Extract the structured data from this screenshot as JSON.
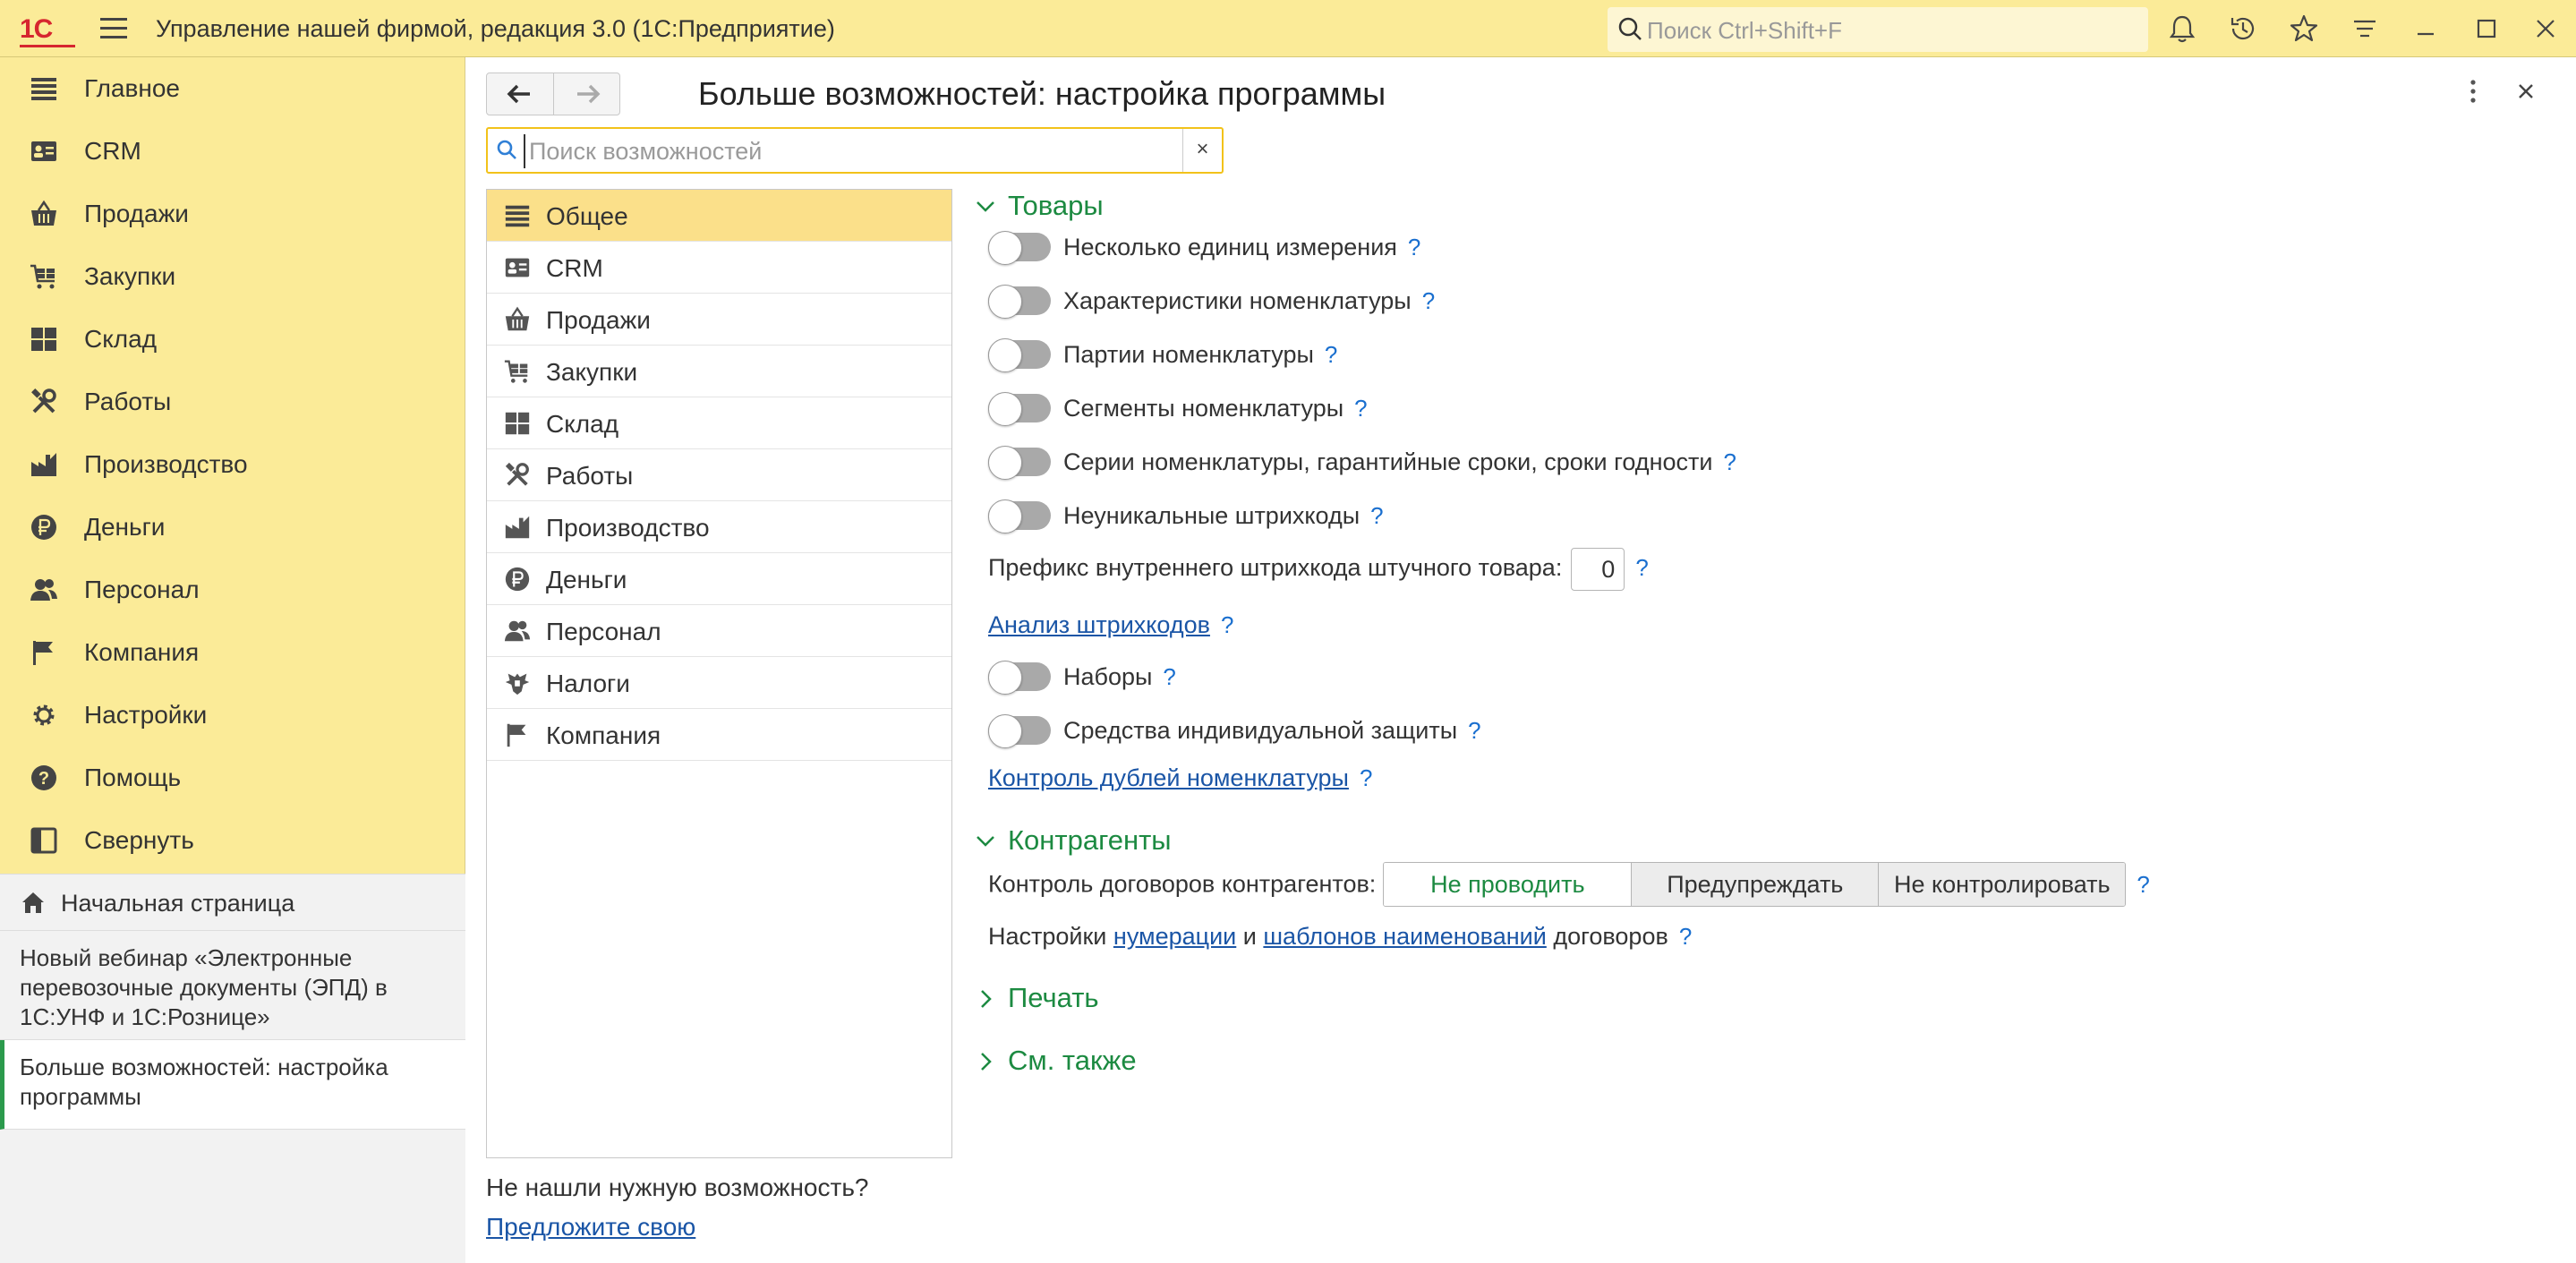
{
  "app": {
    "logo": "1С",
    "title": "Управление нашей фирмой, редакция 3.0  (1С:Предприятие)",
    "search_placeholder": "Поиск Ctrl+Shift+F"
  },
  "sidebar": {
    "items": [
      {
        "label": "Главное",
        "icon": "menu-lines-icon"
      },
      {
        "label": "CRM",
        "icon": "contact-card-icon"
      },
      {
        "label": "Продажи",
        "icon": "basket-icon"
      },
      {
        "label": "Закупки",
        "icon": "cart-icon"
      },
      {
        "label": "Склад",
        "icon": "grid-icon"
      },
      {
        "label": "Работы",
        "icon": "tools-icon"
      },
      {
        "label": "Производство",
        "icon": "factory-icon"
      },
      {
        "label": "Деньги",
        "icon": "ruble-coin-icon"
      },
      {
        "label": "Персонал",
        "icon": "people-icon"
      },
      {
        "label": "Компания",
        "icon": "flag-icon"
      },
      {
        "label": "Настройки",
        "icon": "gear-icon"
      },
      {
        "label": "Помощь",
        "icon": "help-icon"
      },
      {
        "label": "Свернуть",
        "icon": "collapse-panel-icon"
      }
    ],
    "home": "Начальная страница",
    "open_docs": [
      "Новый вебинар «Электронные перевозочные документы (ЭПД) в 1С:УНФ и 1С:Рознице»",
      "Больше возможностей: настройка программы"
    ]
  },
  "main": {
    "title": "Больше возможностей: настройка программы",
    "search_placeholder": "Поиск возможностей",
    "clear_label": "×",
    "sections": [
      {
        "label": "Общее",
        "icon": "menu-lines-icon"
      },
      {
        "label": "CRM",
        "icon": "contact-card-icon"
      },
      {
        "label": "Продажи",
        "icon": "basket-icon"
      },
      {
        "label": "Закупки",
        "icon": "cart-icon"
      },
      {
        "label": "Склад",
        "icon": "grid-icon"
      },
      {
        "label": "Работы",
        "icon": "tools-icon"
      },
      {
        "label": "Производство",
        "icon": "factory-icon"
      },
      {
        "label": "Деньги",
        "icon": "ruble-coin-icon"
      },
      {
        "label": "Персонал",
        "icon": "people-icon"
      },
      {
        "label": "Налоги",
        "icon": "eagle-emblem-icon"
      },
      {
        "label": "Компания",
        "icon": "flag-icon"
      }
    ],
    "not_found": "Не нашли нужную возможность?",
    "suggest_link": "Предложите свою"
  },
  "settings": {
    "goods": {
      "title": "Товары",
      "toggles_a": [
        "Несколько единиц измерения",
        "Характеристики номенклатуры",
        "Партии номенклатуры",
        "Сегменты номенклатуры",
        "Серии номенклатуры, гарантийные сроки, сроки годности",
        "Неуникальные штрихкоды"
      ],
      "barcode_prefix_label": "Префикс внутреннего штрихкода штучного товара:",
      "barcode_prefix_value": "0",
      "barcode_analysis_link": "Анализ штрихкодов",
      "toggles_b": [
        "Наборы",
        "Средства индивидуальной защиты"
      ],
      "duplicates_link": "Контроль дублей номенклатуры"
    },
    "counterparties": {
      "title": "Контрагенты",
      "contract_control_label": "Контроль договоров контрагентов:",
      "contract_control_options": [
        "Не проводить",
        "Предупреждать",
        "Не контролировать"
      ],
      "contract_control_selected": "Не проводить",
      "numbering_prefix": "Настройки",
      "numbering_link": "нумерации",
      "numbering_and": "и",
      "templates_link": "шаблонов наименований",
      "numbering_suffix": "договоров"
    },
    "print": {
      "title": "Печать"
    },
    "see_also": {
      "title": "См. также"
    },
    "help_mark": "?"
  }
}
